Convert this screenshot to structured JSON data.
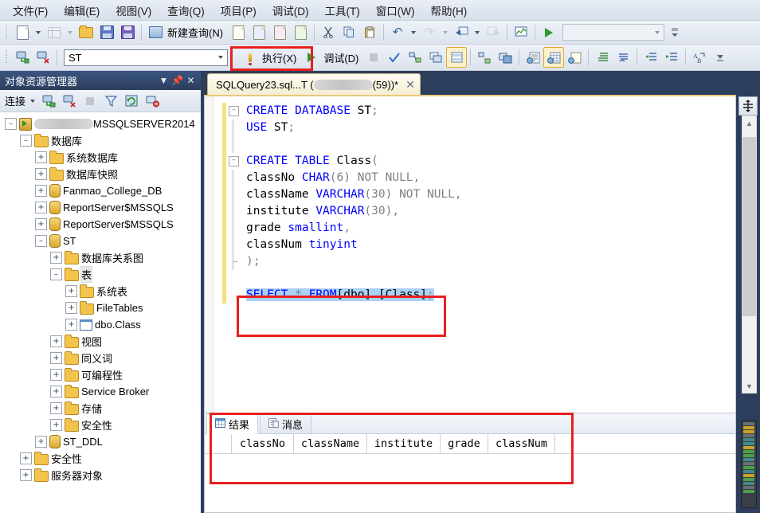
{
  "menu": {
    "items": [
      {
        "label": "文件(F)",
        "name": "menu-file"
      },
      {
        "label": "编辑(E)",
        "name": "menu-edit"
      },
      {
        "label": "视图(V)",
        "name": "menu-view"
      },
      {
        "label": "查询(Q)",
        "name": "menu-query"
      },
      {
        "label": "项目(P)",
        "name": "menu-project"
      },
      {
        "label": "调试(D)",
        "name": "menu-debug"
      },
      {
        "label": "工具(T)",
        "name": "menu-tools"
      },
      {
        "label": "窗口(W)",
        "name": "menu-window"
      },
      {
        "label": "帮助(H)",
        "name": "menu-help"
      }
    ]
  },
  "toolbar_main": {
    "new_query_label": "新建查询(N)",
    "icons": [
      "new-item-icon",
      "new-table-icon",
      "open-file-icon",
      "save-icon",
      "save-all-icon",
      "new-query-icon",
      "new-db-engine-query-icon",
      "new-mdx-query-icon",
      "new-dmx-query-icon",
      "new-xmla-query-icon",
      "cut-icon",
      "copy-icon",
      "paste-icon",
      "undo-icon",
      "redo-icon",
      "navigate-backward-icon",
      "navigate-forward-icon",
      "activity-monitor-icon",
      "start-debug-icon"
    ],
    "combo_value": ""
  },
  "toolbar_query": {
    "database_value": "ST",
    "execute_label": "执行(X)",
    "debug_label": "调试(D)",
    "icons": [
      "available-databases-icon",
      "connect-icon",
      "change-connection-icon",
      "stop-icon",
      "parse-icon",
      "display-estimated-plan-icon",
      "query-options-icon",
      "include-actual-plan-icon",
      "include-client-statistics-icon",
      "results-to-text-icon",
      "results-to-grid-icon",
      "results-to-file-icon",
      "comment-icon",
      "uncomment-icon",
      "decrease-indent-icon",
      "increase-indent-icon",
      "specify-values-icon"
    ]
  },
  "object_explorer": {
    "title": "对象资源管理器",
    "title_buttons": [
      "dropdown-icon",
      "pin-icon",
      "close-icon"
    ],
    "connect_label": "连接",
    "tools": [
      "connect-server-icon",
      "disconnect-server-icon",
      "stop-icon",
      "filter-icon",
      "refresh-icon",
      "disconnect-all-icon"
    ],
    "tree": [
      {
        "label": "MSSQLSERVER2014",
        "indent": 0,
        "expander": "minus",
        "icon": "server-icon",
        "redacted": true,
        "name": "tree-node-server"
      },
      {
        "label": "数据库",
        "indent": 1,
        "expander": "minus",
        "icon": "folder-icon",
        "name": "tree-node-databases"
      },
      {
        "label": "系统数据库",
        "indent": 2,
        "expander": "plus",
        "icon": "folder-icon",
        "name": "tree-node-system-databases"
      },
      {
        "label": "数据库快照",
        "indent": 2,
        "expander": "plus",
        "icon": "folder-icon",
        "name": "tree-node-database-snapshots"
      },
      {
        "label": "Fanmao_College_DB",
        "indent": 2,
        "expander": "plus",
        "icon": "database-icon",
        "name": "tree-node-fanmao-college-db"
      },
      {
        "label": "ReportServer$MSSQLS",
        "indent": 2,
        "expander": "plus",
        "icon": "database-icon",
        "name": "tree-node-reportserver"
      },
      {
        "label": "ReportServer$MSSQLS",
        "indent": 2,
        "expander": "plus",
        "icon": "database-icon",
        "name": "tree-node-reportserver-tempdb"
      },
      {
        "label": "ST",
        "indent": 2,
        "expander": "minus",
        "icon": "database-icon",
        "name": "tree-node-st"
      },
      {
        "label": "数据库关系图",
        "indent": 3,
        "expander": "plus",
        "icon": "folder-icon",
        "name": "tree-node-database-diagrams"
      },
      {
        "label": "表",
        "indent": 3,
        "expander": "minus",
        "icon": "folder-icon",
        "selected": true,
        "name": "tree-node-tables"
      },
      {
        "label": "系统表",
        "indent": 4,
        "expander": "plus",
        "icon": "folder-icon",
        "name": "tree-node-system-tables"
      },
      {
        "label": "FileTables",
        "indent": 4,
        "expander": "plus",
        "icon": "folder-icon",
        "name": "tree-node-filetables"
      },
      {
        "label": "dbo.Class",
        "indent": 4,
        "expander": "plus",
        "icon": "table-icon",
        "name": "tree-node-dbo-class"
      },
      {
        "label": "视图",
        "indent": 3,
        "expander": "plus",
        "icon": "folder-icon",
        "name": "tree-node-views"
      },
      {
        "label": "同义词",
        "indent": 3,
        "expander": "plus",
        "icon": "folder-icon",
        "name": "tree-node-synonyms"
      },
      {
        "label": "可编程性",
        "indent": 3,
        "expander": "plus",
        "icon": "folder-icon",
        "name": "tree-node-programmability"
      },
      {
        "label": "Service Broker",
        "indent": 3,
        "expander": "plus",
        "icon": "folder-icon",
        "name": "tree-node-service-broker"
      },
      {
        "label": "存储",
        "indent": 3,
        "expander": "plus",
        "icon": "folder-icon",
        "name": "tree-node-storage"
      },
      {
        "label": "安全性",
        "indent": 3,
        "expander": "plus",
        "icon": "folder-icon",
        "name": "tree-node-security-db"
      },
      {
        "label": "ST_DDL",
        "indent": 2,
        "expander": "plus",
        "icon": "database-icon",
        "name": "tree-node-st-ddl"
      },
      {
        "label": "安全性",
        "indent": 1,
        "expander": "plus",
        "icon": "folder-icon",
        "name": "tree-node-security-server"
      },
      {
        "label": "服务器对象",
        "indent": 1,
        "expander": "plus",
        "icon": "folder-icon",
        "name": "tree-node-server-objects"
      }
    ]
  },
  "editor": {
    "tab_prefix": "SQLQuery23.sql...T (",
    "tab_suffix": "(59))*",
    "close_label": "✕",
    "zoom": "100 %",
    "lines": [
      {
        "fold": "minus",
        "tokens": [
          {
            "t": "CREATE DATABASE",
            "c": "kw"
          },
          {
            "t": " ST",
            "c": "plain"
          },
          {
            "t": ";",
            "c": "punct"
          }
        ]
      },
      {
        "bar": true,
        "tokens": [
          {
            "t": "USE",
            "c": "kw"
          },
          {
            "t": " ST",
            "c": "plain"
          },
          {
            "t": ";",
            "c": "punct"
          }
        ]
      },
      {
        "bar": true,
        "tokens": []
      },
      {
        "fold": "minus",
        "tokens": [
          {
            "t": "CREATE TABLE",
            "c": "kw"
          },
          {
            "t": " Class",
            "c": "plain"
          },
          {
            "t": "(",
            "c": "punct"
          }
        ]
      },
      {
        "bar": true,
        "tokens": [
          {
            "t": "classNo ",
            "c": "plain"
          },
          {
            "t": "CHAR",
            "c": "kw"
          },
          {
            "t": "(6) ",
            "c": "punct"
          },
          {
            "t": "NOT NULL",
            "c": "gray"
          },
          {
            "t": ",",
            "c": "punct"
          }
        ]
      },
      {
        "bar": true,
        "tokens": [
          {
            "t": "className ",
            "c": "plain"
          },
          {
            "t": "VARCHAR",
            "c": "kw"
          },
          {
            "t": "(30) ",
            "c": "punct"
          },
          {
            "t": "NOT NULL",
            "c": "gray"
          },
          {
            "t": ",",
            "c": "punct"
          }
        ]
      },
      {
        "bar": true,
        "tokens": [
          {
            "t": "institute ",
            "c": "plain"
          },
          {
            "t": "VARCHAR",
            "c": "kw"
          },
          {
            "t": "(30)",
            "c": "punct"
          },
          {
            "t": ",",
            "c": "punct"
          }
        ]
      },
      {
        "bar": true,
        "tokens": [
          {
            "t": "grade ",
            "c": "plain"
          },
          {
            "t": "smallint",
            "c": "kw"
          },
          {
            "t": ",",
            "c": "punct"
          }
        ]
      },
      {
        "bar": true,
        "tokens": [
          {
            "t": "classNum ",
            "c": "plain"
          },
          {
            "t": "tinyint",
            "c": "kw"
          }
        ]
      },
      {
        "bar": true,
        "vend": true,
        "tokens": [
          {
            "t": ")",
            "c": "punct"
          },
          {
            "t": ";",
            "c": "punct"
          }
        ]
      },
      {
        "tokens": []
      },
      {
        "selected": true,
        "tokens": [
          {
            "t": "SELECT",
            "c": "kw"
          },
          {
            "t": " * ",
            "c": "gray"
          },
          {
            "t": "FROM",
            "c": "kw"
          },
          {
            "t": "[dbo].[Class]",
            "c": "plain"
          },
          {
            "t": ";",
            "c": "punct"
          }
        ]
      }
    ]
  },
  "results": {
    "tabs": [
      {
        "label": "结果",
        "icon": "grid-icon",
        "active": true,
        "name": "tab-results"
      },
      {
        "label": "消息",
        "icon": "message-icon",
        "active": false,
        "name": "tab-messages"
      }
    ],
    "columns": [
      "classNo",
      "className",
      "institute",
      "grade",
      "classNum"
    ],
    "rows": []
  },
  "colors": {
    "annotation": "#e8201c",
    "keyword": "#0000ff",
    "selection": "#a9d1f5",
    "change_bar": "#f6e07a",
    "panel_chrome": "#2c3e5c"
  }
}
